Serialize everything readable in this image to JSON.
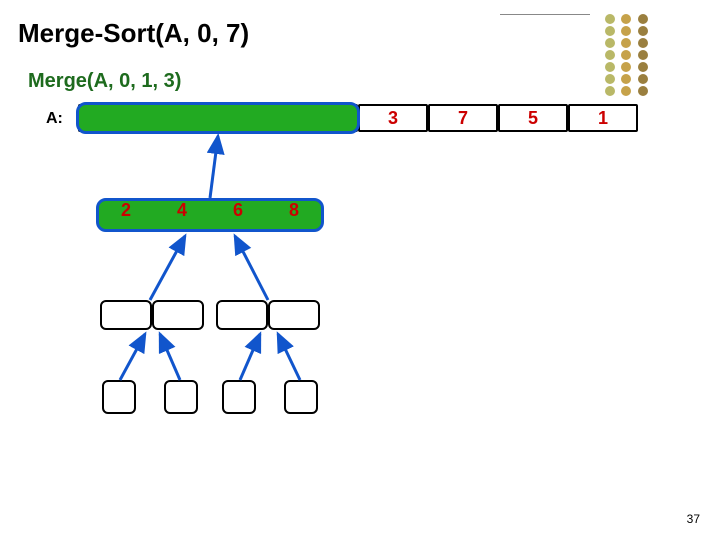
{
  "title": "Merge-Sort(A, 0, 7)",
  "subtitle": "Merge(A, 0, 1, 3)",
  "array_label": "A:",
  "slide_number": "37",
  "top_row": {
    "cells": [
      "",
      "",
      "",
      "",
      "3",
      "7",
      "5",
      "1"
    ]
  },
  "level1": {
    "cells": [
      "2",
      "4",
      "6",
      "8"
    ]
  },
  "dot_colors": {
    "col1": "#b9b867",
    "col2": "#c6a24a",
    "col3": "#9a7f3f"
  }
}
